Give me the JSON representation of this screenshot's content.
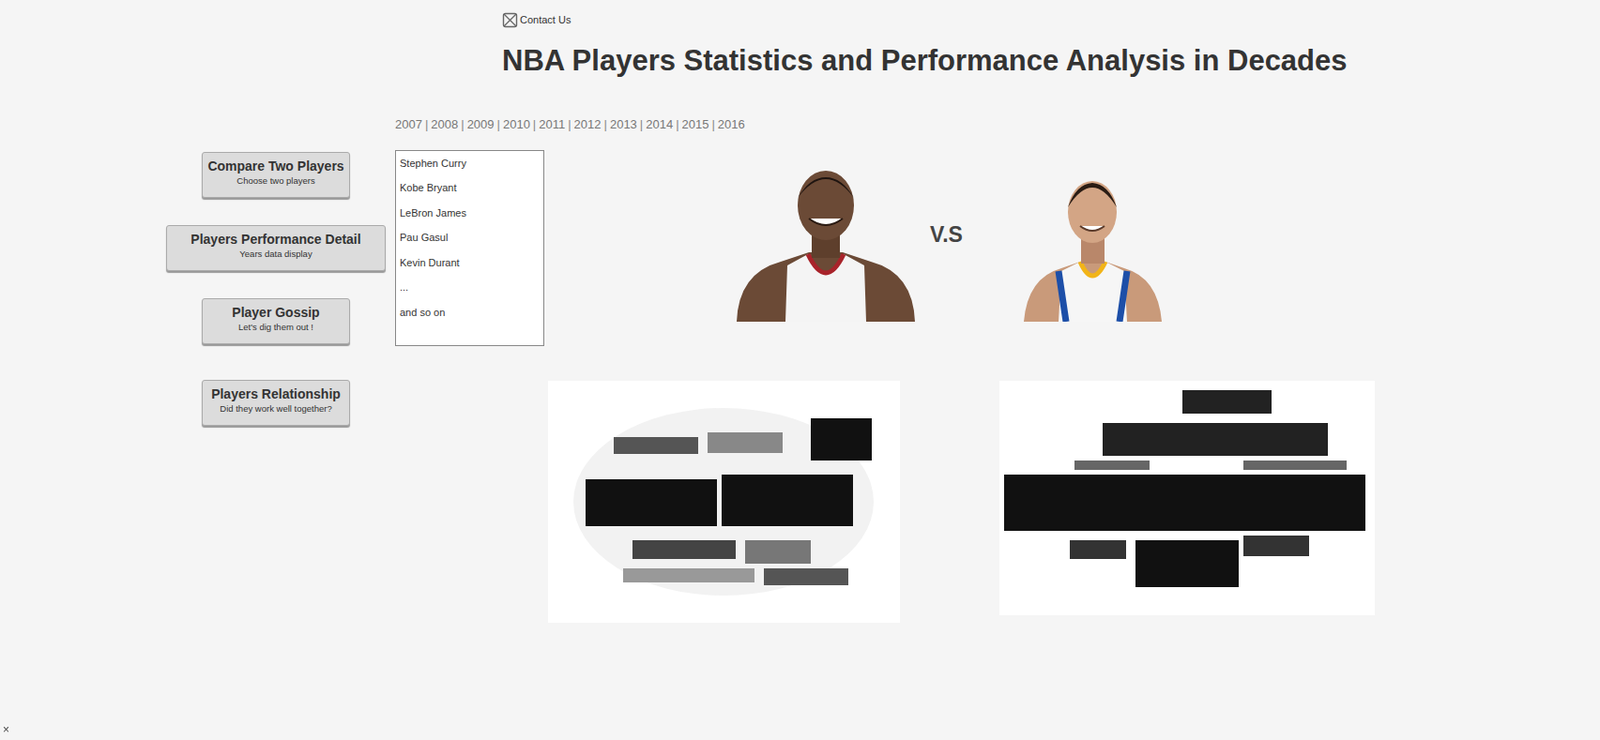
{
  "contact": {
    "label": "Contact Us"
  },
  "title": "NBA Players Statistics and Performance Analysis in Decades",
  "separator": "|",
  "years": [
    {
      "label": "2007"
    },
    {
      "label": "2008"
    },
    {
      "label": "2009"
    },
    {
      "label": "2010"
    },
    {
      "label": "2011"
    },
    {
      "label": "2012"
    },
    {
      "label": "2013"
    },
    {
      "label": "2014"
    },
    {
      "label": "2015"
    },
    {
      "label": "2016"
    }
  ],
  "menu": [
    {
      "title": "Compare Two Players",
      "subtitle": "Choose two players"
    },
    {
      "title": "Players Performance Detail",
      "subtitle": "Years data display"
    },
    {
      "title": "Player Gossip",
      "subtitle": "Let's dig them out !"
    },
    {
      "title": "Players Relationship",
      "subtitle": "Did they work well together?"
    }
  ],
  "players": [
    "Stephen Curry",
    "Kobe Bryant",
    "LeBron James",
    "Pau Gasul",
    "Kevin Durant",
    "...",
    "and so on"
  ],
  "versus": "V.S",
  "corner": "×"
}
